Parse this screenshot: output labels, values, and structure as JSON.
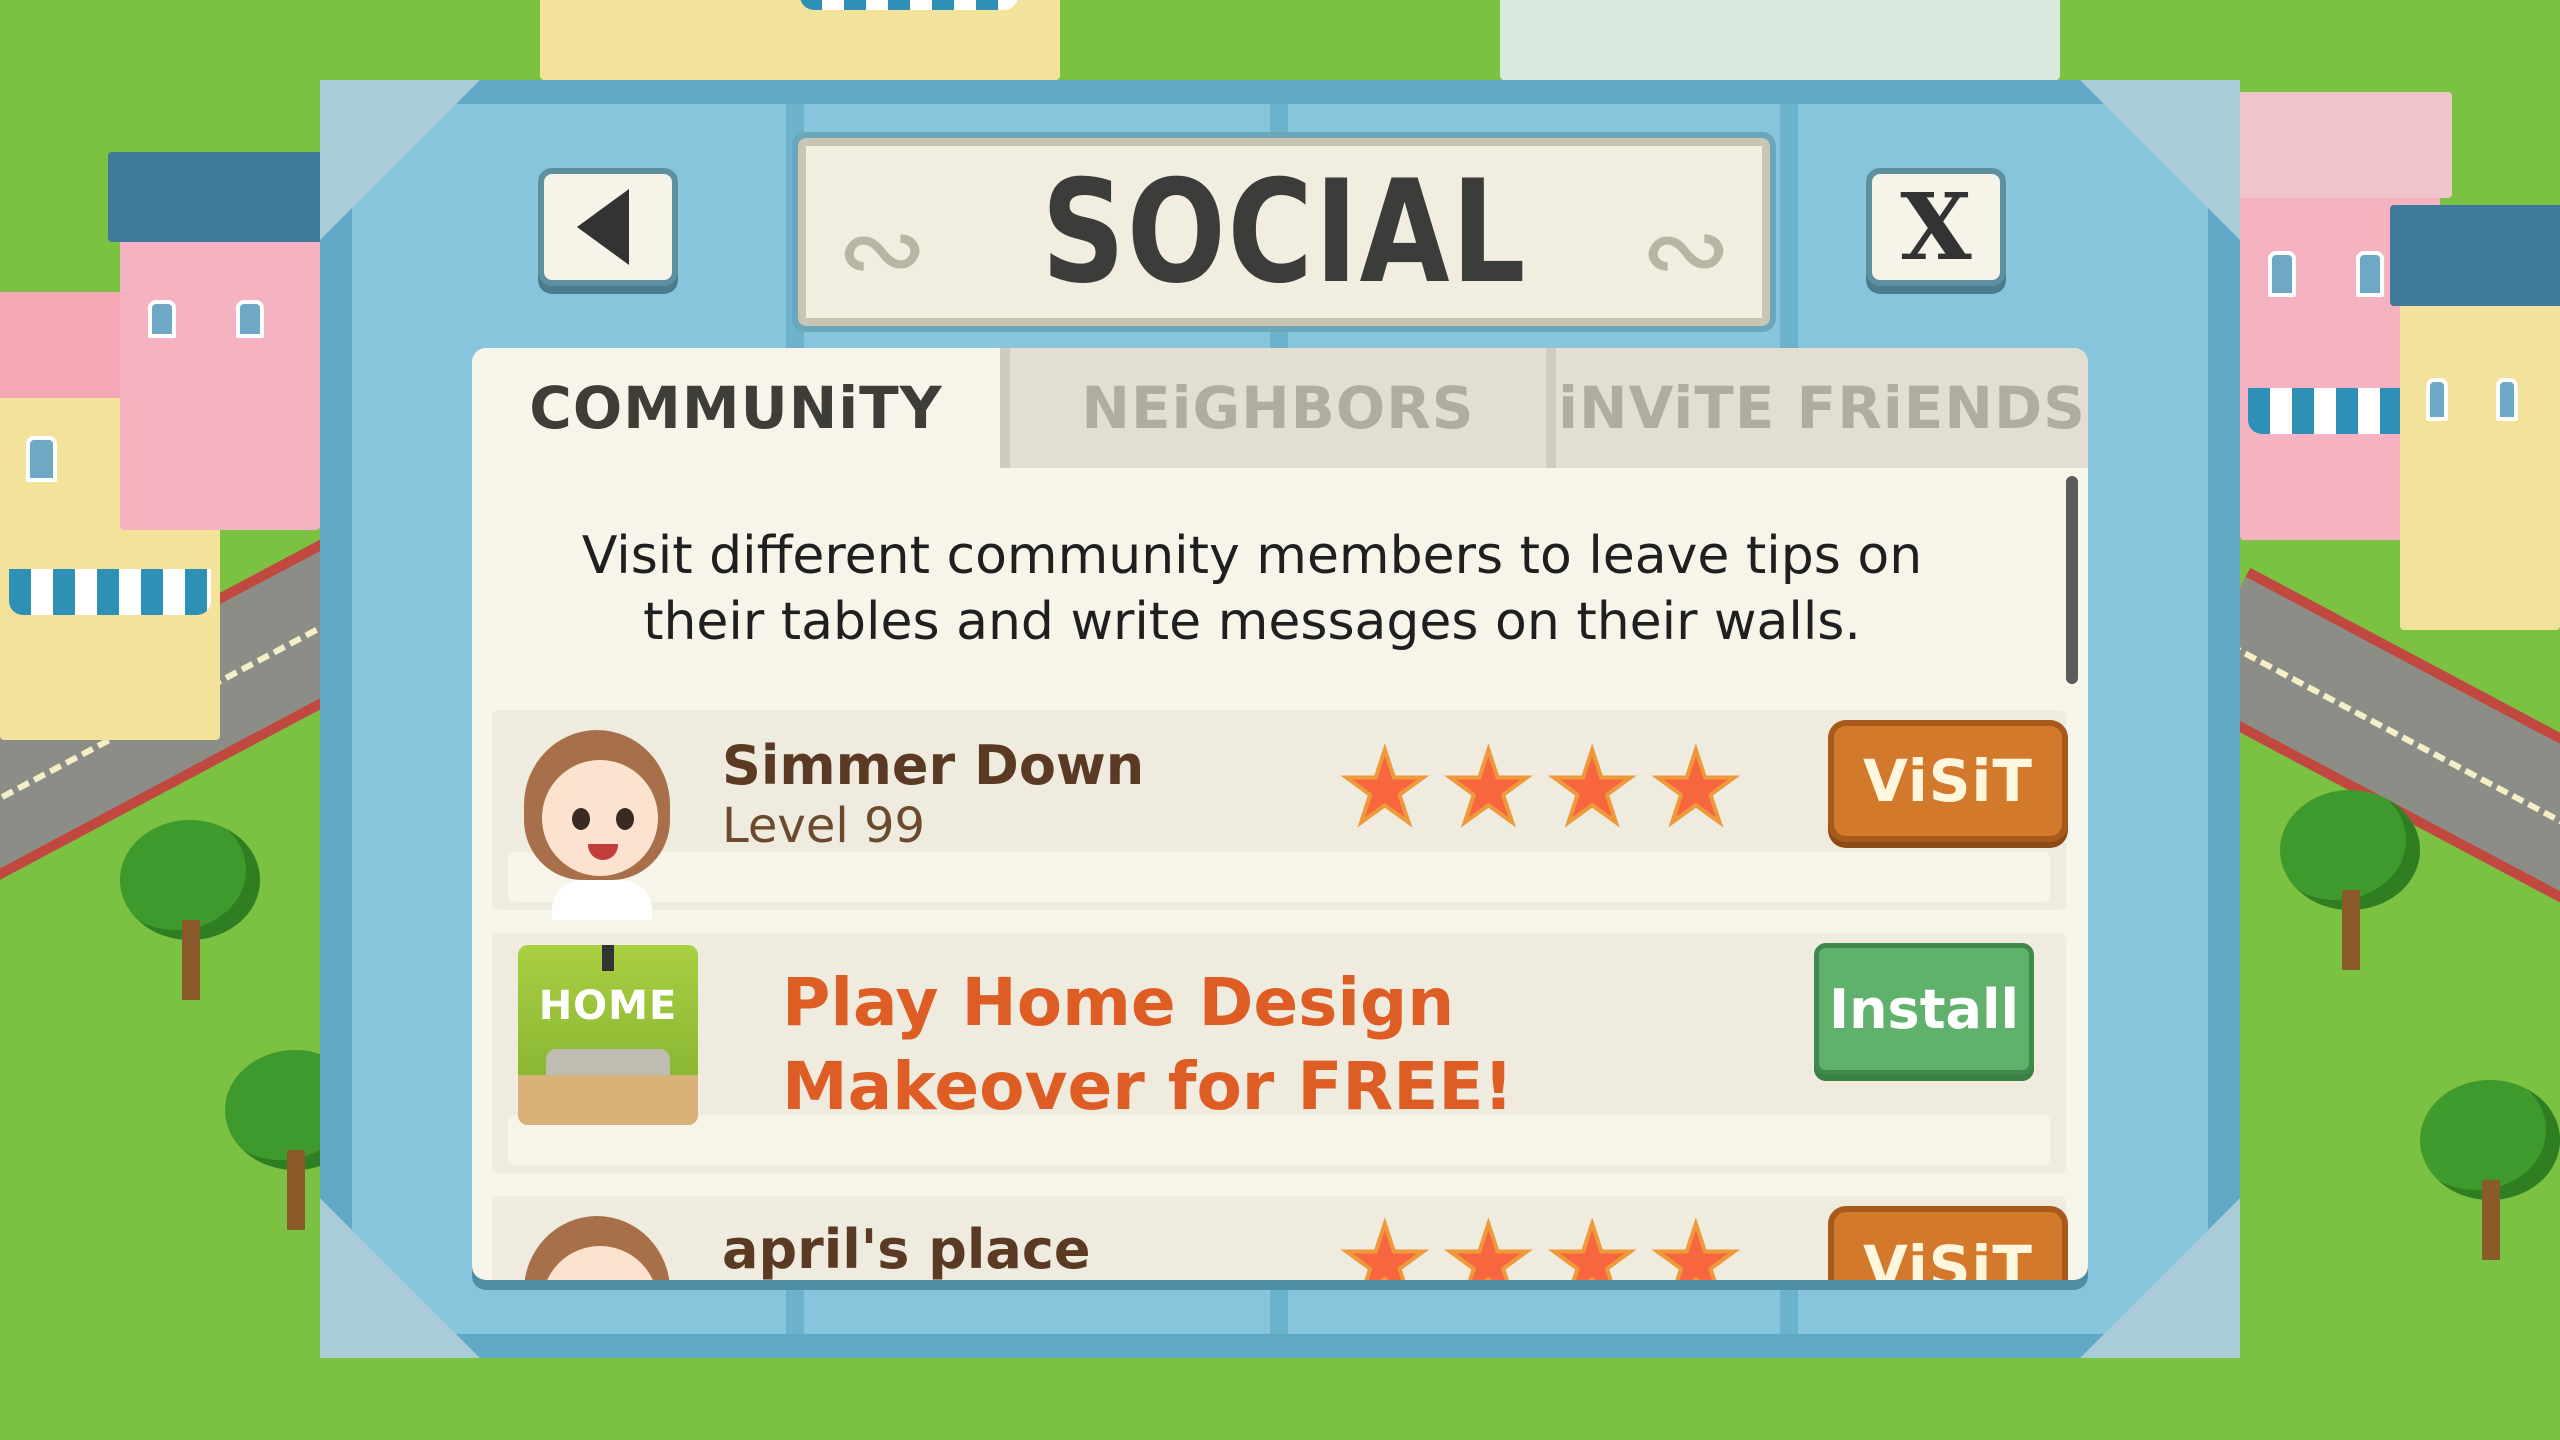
{
  "dialog": {
    "title": "SOCIAL",
    "back_icon": "back-arrow-icon",
    "close_label": "X"
  },
  "tabs": [
    {
      "label": "COMMUNiTY",
      "active": true
    },
    {
      "label": "NEiGHBORS",
      "active": false
    },
    {
      "label": "iNViTE FRiENDS",
      "active": false
    }
  ],
  "description": "Visit different community members to leave tips on their tables and write messages on their walls.",
  "members": [
    {
      "name": "Simmer Down",
      "level": "Level 99",
      "rating": 4,
      "button": "ViSiT"
    },
    {
      "name": "april's place",
      "rating": 4,
      "button": "ViSiT"
    }
  ],
  "promo": {
    "icon_label": "HOME",
    "text": "Play Home Design Makeover for FREE!",
    "button": "Install"
  },
  "colors": {
    "frame": "#5fa9c7",
    "visit_button": "#d2792c",
    "install_button": "#5fb16b",
    "promo_text": "#dd5d24",
    "star": "#f7663f"
  }
}
